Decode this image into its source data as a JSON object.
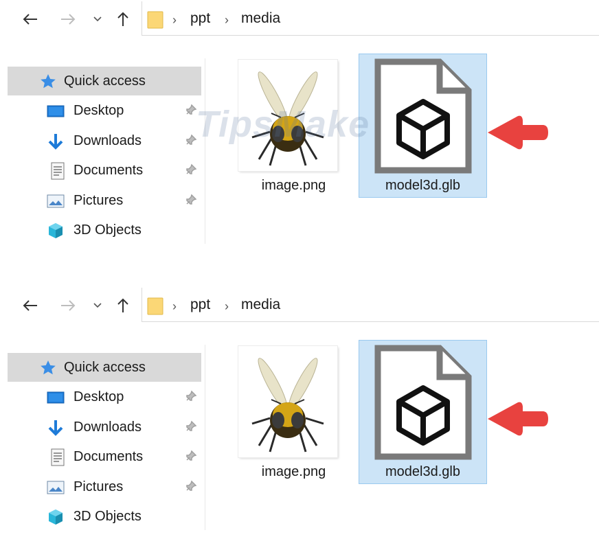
{
  "panels": [
    {
      "breadcrumb": [
        "ppt",
        "media"
      ],
      "sidebar": [
        {
          "label": "Quick access",
          "icon": "star-icon"
        },
        {
          "label": "Desktop",
          "icon": "desktop-icon"
        },
        {
          "label": "Downloads",
          "icon": "download-icon"
        },
        {
          "label": "Documents",
          "icon": "documents-icon"
        },
        {
          "label": "Pictures",
          "icon": "pictures-icon"
        },
        {
          "label": "3D Objects",
          "icon": "3d-objects-icon"
        }
      ],
      "files": [
        {
          "name": "image.png",
          "type": "image",
          "selected": false
        },
        {
          "name": "model3d.glb",
          "type": "glb",
          "selected": true
        }
      ],
      "watermark": "TipsMake"
    },
    {
      "breadcrumb": [
        "ppt",
        "media"
      ],
      "sidebar": [
        {
          "label": "Quick access",
          "icon": "star-icon"
        },
        {
          "label": "Desktop",
          "icon": "desktop-icon"
        },
        {
          "label": "Downloads",
          "icon": "download-icon"
        },
        {
          "label": "Documents",
          "icon": "documents-icon"
        },
        {
          "label": "Pictures",
          "icon": "pictures-icon"
        },
        {
          "label": "3D Objects",
          "icon": "3d-objects-icon"
        }
      ],
      "files": [
        {
          "name": "image.png",
          "type": "image",
          "selected": false
        },
        {
          "name": "model3d.glb",
          "type": "glb",
          "selected": true
        }
      ]
    }
  ],
  "colors": {
    "selection": "#cce4f7",
    "selection_border": "#99c9ef",
    "arrow": "#e8423f",
    "quick_access_bg": "#d9d9d9"
  }
}
